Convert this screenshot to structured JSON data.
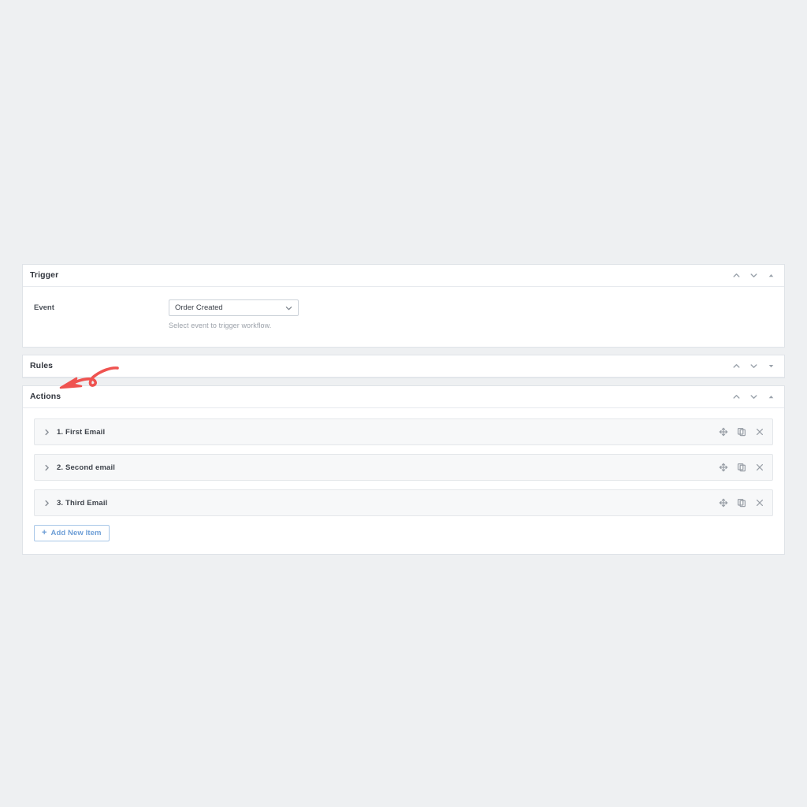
{
  "panels": [
    {
      "id": "trigger",
      "title": "Trigger",
      "expanded": true,
      "controls": [
        "chevron-up",
        "chevron-down",
        "triangle-up"
      ]
    },
    {
      "id": "rules",
      "title": "Rules",
      "expanded": false,
      "controls": [
        "chevron-up",
        "chevron-down",
        "triangle-down"
      ]
    },
    {
      "id": "actions",
      "title": "Actions",
      "expanded": true,
      "controls": [
        "chevron-up",
        "chevron-down",
        "triangle-up"
      ]
    }
  ],
  "trigger": {
    "title": "Trigger",
    "field": {
      "label": "Event",
      "value": "Order Created",
      "options": [
        "Order Created"
      ],
      "help": "Select event to trigger workflow."
    }
  },
  "rules": {
    "title": "Rules"
  },
  "actions": {
    "title": "Actions",
    "items": [
      {
        "label": "1. First Email"
      },
      {
        "label": "2. Second email"
      },
      {
        "label": "3. Third Email"
      }
    ],
    "row_tools": [
      "move-icon",
      "duplicate-icon",
      "close-icon"
    ],
    "add_button": {
      "plus": "+",
      "label": "Add New Item"
    }
  },
  "annotation": {
    "type": "hand-drawn-arrow",
    "color": "#ef5350",
    "points_to": "Actions"
  },
  "colors": {
    "page_background": "#eef0f2",
    "panel_background": "#ffffff",
    "panel_border": "#dfe3e8",
    "row_background": "#f7f8f9",
    "accent_blue": "#6d9ed6",
    "annotation_red": "#ef5350"
  }
}
